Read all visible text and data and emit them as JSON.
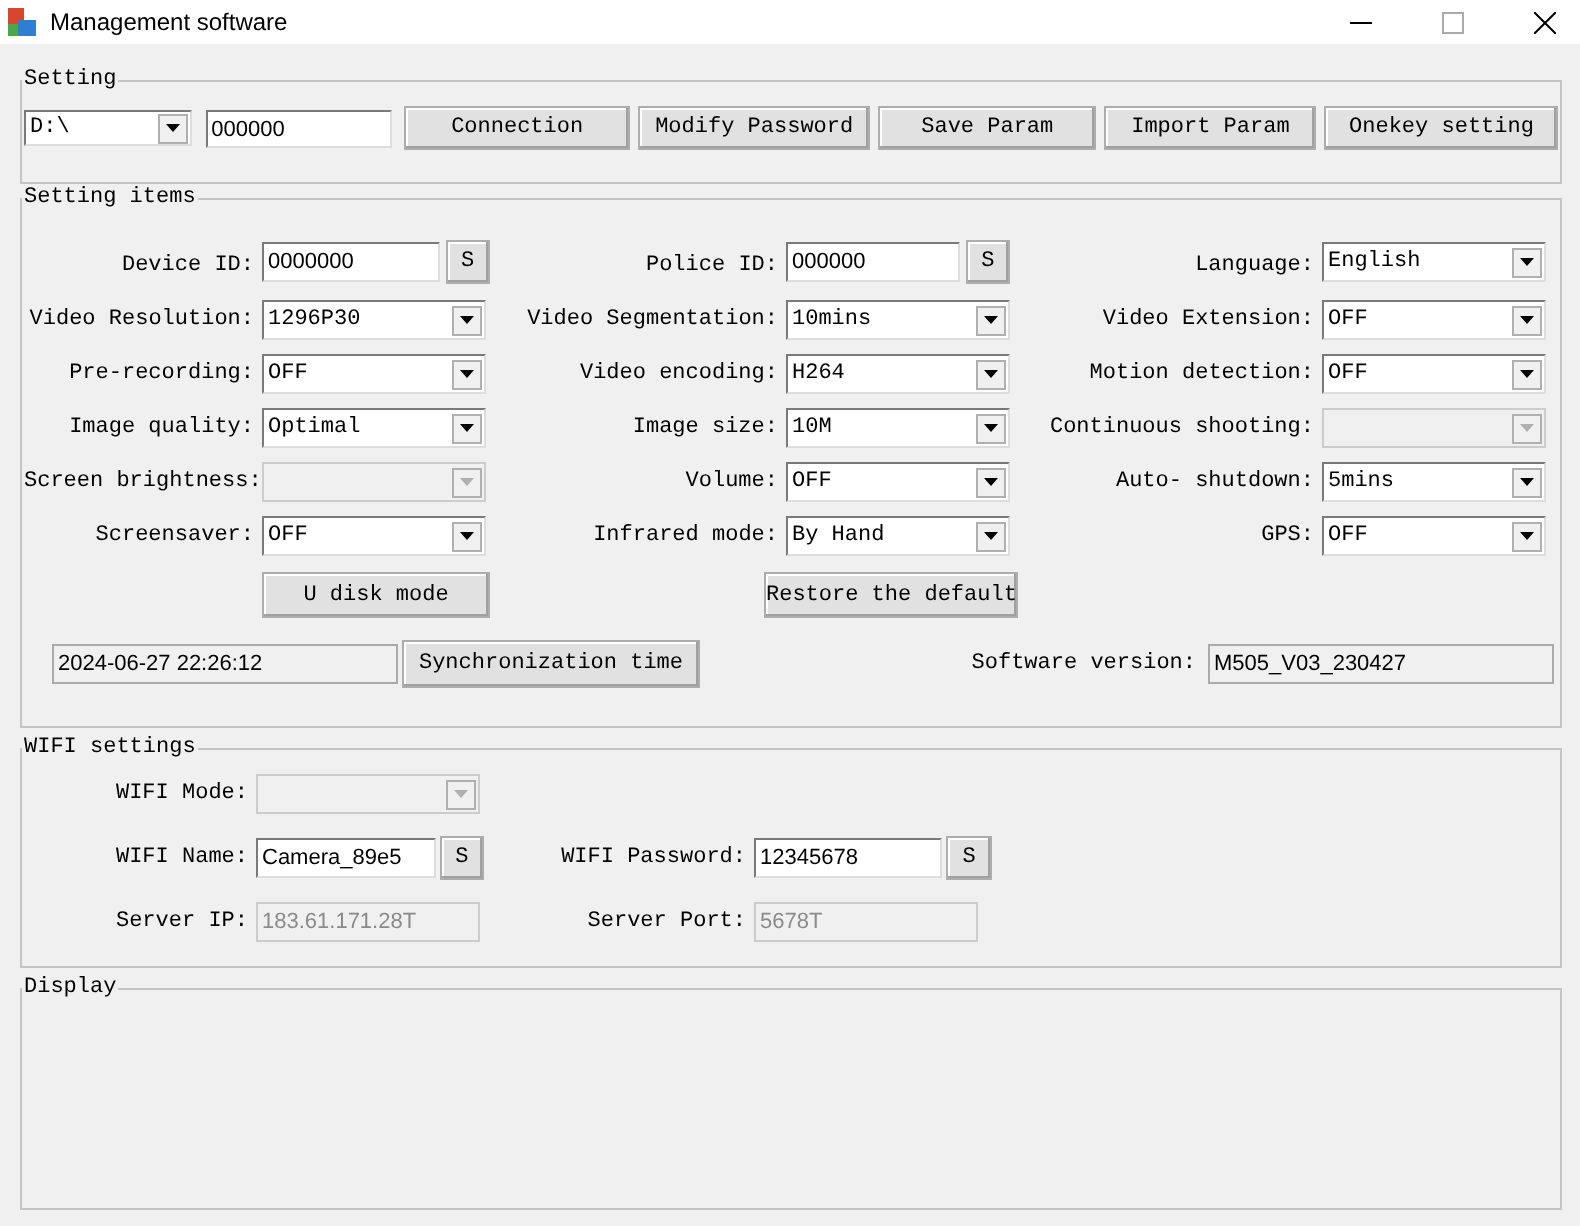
{
  "window": {
    "title": "Management software"
  },
  "setting": {
    "title": "Setting",
    "drive": {
      "value": "D:\\",
      "disabled": false
    },
    "password": {
      "value": "000000"
    },
    "buttons": [
      "Connection",
      "Modify Password",
      "Save Param",
      "Import Param",
      "Onekey setting"
    ]
  },
  "setting_items": {
    "title": "Setting items",
    "fields": [
      {
        "label": "Device ID:",
        "kind": "text",
        "value": "0000000",
        "button": "S",
        "disabled": false
      },
      {
        "label": "Police ID:",
        "kind": "text",
        "value": "000000",
        "button": "S",
        "disabled": false
      },
      {
        "label": "Language:",
        "kind": "dropdown",
        "value": "English",
        "disabled": false
      },
      {
        "label": "Video Resolution:",
        "kind": "dropdown",
        "value": "1296P30",
        "disabled": false
      },
      {
        "label": "Video Segmentation:",
        "kind": "dropdown",
        "value": "10mins",
        "disabled": false
      },
      {
        "label": "Video Extension:",
        "kind": "dropdown",
        "value": "OFF",
        "disabled": false
      },
      {
        "label": "Pre-recording:",
        "kind": "dropdown",
        "value": "OFF",
        "disabled": false
      },
      {
        "label": "Video encoding:",
        "kind": "dropdown",
        "value": "H264",
        "disabled": false
      },
      {
        "label": "Motion detection:",
        "kind": "dropdown",
        "value": "OFF",
        "disabled": false
      },
      {
        "label": "Image quality:",
        "kind": "dropdown",
        "value": "Optimal",
        "disabled": false
      },
      {
        "label": "Image size:",
        "kind": "dropdown",
        "value": "10M",
        "disabled": false
      },
      {
        "label": "Continuous shooting:",
        "kind": "dropdown",
        "disabled": true
      },
      {
        "label": "Screen brightness:",
        "kind": "dropdown",
        "disabled": true
      },
      {
        "label": "Volume:",
        "kind": "dropdown",
        "value": "OFF",
        "disabled": false
      },
      {
        "label": "Auto- shutdown:",
        "kind": "dropdown",
        "value": "5mins",
        "disabled": false
      },
      {
        "label": "Screensaver:",
        "kind": "dropdown",
        "value": "OFF",
        "disabled": false
      },
      {
        "label": "Infrared mode:",
        "kind": "dropdown",
        "value": "By Hand",
        "disabled": false
      },
      {
        "label": "GPS:",
        "kind": "dropdown",
        "value": "OFF",
        "disabled": false
      }
    ],
    "buttons": [
      "U disk mode",
      "Restore the default"
    ],
    "time": {
      "value": "2024-06-27 22:26:12",
      "readonly": true
    },
    "sync_button": "Synchronization time",
    "version": {
      "label": "Software version:",
      "value": "M505_V03_230427",
      "readonly": true
    }
  },
  "wifi": {
    "title": "WIFI settings",
    "fields": [
      {
        "label": "WIFI Mode:",
        "kind": "dropdown",
        "disabled": true
      },
      {
        "label": "WIFI Name:",
        "kind": "text",
        "value": "Camera_89e5",
        "button": "S",
        "disabled": false
      },
      {
        "label": "WIFI Password:",
        "kind": "text",
        "value": "12345678",
        "button": "S",
        "disabled": false
      },
      {
        "label": "Server IP:",
        "kind": "text",
        "value": "183.61.171.28T",
        "disabled": true
      },
      {
        "label": "Server Port:",
        "kind": "text",
        "value": "5678T",
        "disabled": true
      }
    ]
  },
  "display": {
    "title": "Display"
  }
}
